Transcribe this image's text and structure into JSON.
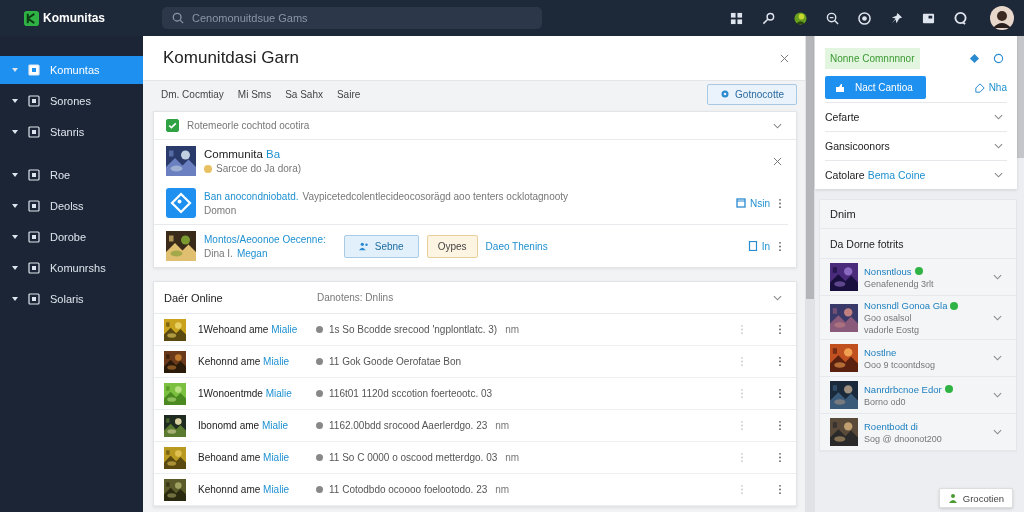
{
  "topbar": {
    "logo": "Komunitas",
    "search": {
      "placeholder": "Cenomonuitdsue Gams"
    }
  },
  "sidebar": {
    "items": [
      {
        "label": "Komuntas",
        "selected": true
      },
      {
        "label": "Sorones",
        "selected": false
      },
      {
        "label": "Stanris",
        "selected": false
      },
      {
        "label": "Roe",
        "selected": false
      },
      {
        "label": "Deolss",
        "selected": false
      },
      {
        "label": "Dorobe",
        "selected": false
      },
      {
        "label": "Komunrshs",
        "selected": false
      },
      {
        "label": "Solaris",
        "selected": false
      }
    ]
  },
  "panel": {
    "title": "Komunitdasi Garn",
    "tabs": [
      {
        "label": "Dm. Cocmtiay",
        "selected": false
      },
      {
        "label": "Mi Sms",
        "selected": false
      },
      {
        "label": "Sa Sahx",
        "selected": false
      },
      {
        "label": "Saire",
        "selected": false
      }
    ],
    "action": "Gotnocotte",
    "card": {
      "header": "Rotemeorle cochtod ocotira",
      "checked": true,
      "community": {
        "name": "Communita",
        "tag": "Ba",
        "status": "Sarcoe do Ja dora)"
      },
      "notice": {
        "title": "Ban anocondniobatd.",
        "text": "Vaypicetedcolentlecideocosorägd aoo tenters ocklotagnooty",
        "sub": "Domon",
        "link": "Nsin"
      },
      "invite": {
        "title": "Montos/Aeoonoe Oecenne:",
        "name": "Dina I.",
        "name_link": "Megan",
        "primary": "Sebne",
        "secondary": "Oypes",
        "link": "Daeo Thenins",
        "side_link": "In"
      }
    },
    "online": {
      "title": "Daér Online",
      "subtitle": "Danotens: Dnlins",
      "rows": [
        {
          "name": "1Wehoand ame",
          "tag": "Mialie",
          "text": "1s So Bcodde srecood 'ngplontlatc. 3)",
          "suffix": "nm"
        },
        {
          "name": "Kehonnd ame",
          "tag": "Mialie",
          "text": "11 Gok Goode Oerofatae Bon"
        },
        {
          "name": "1Wonoentmde",
          "tag": "Mialie",
          "text": "116t01 1120d sccotion foerteootc. 03"
        },
        {
          "name": "Ibonomd ame",
          "tag": "Mialie",
          "text": "1162.00bdd srocood Aaerlerdgo. 23",
          "suffix": "nm"
        },
        {
          "name": "Behoand ame",
          "tag": "Mialie",
          "text": "11 So C 0000 o oscood metterdgo. 03",
          "suffix": "nm"
        },
        {
          "name": "Kehonnd ame",
          "tag": "Mialie",
          "text": "11 Cotodbdo ocoooo foelootodo. 23",
          "suffix": "nm"
        }
      ]
    }
  },
  "right": {
    "badge": "Nonne Comnnnnor",
    "primary": "Nact Cantioa",
    "link": "Nha",
    "accordion": [
      {
        "label": "Cefarte"
      },
      {
        "label": "Gansicoonors"
      },
      {
        "label": "Catolare",
        "accent": "Bema Coine"
      }
    ],
    "section": "Dnim",
    "list_title": "Da Dorne fotrits",
    "players": [
      {
        "name": "Nonsntlous",
        "sub": "Genafenendg 3rlt",
        "online": true
      },
      {
        "name": "Nonsndl Gonoa Gla",
        "sub": "Goo osalsol",
        "extra": "vadorle Eostg",
        "online": true
      },
      {
        "name": "Nostlne",
        "sub": "Ooo 9 tcoontdsog",
        "online": false
      },
      {
        "name": "Nanrdrbcnoe Edor",
        "sub": "Borno od0",
        "online": true
      },
      {
        "name": "Roentbodt di",
        "sub": "Sog @ dnoonot200",
        "online": false
      }
    ]
  },
  "floating": "Grocotien"
}
